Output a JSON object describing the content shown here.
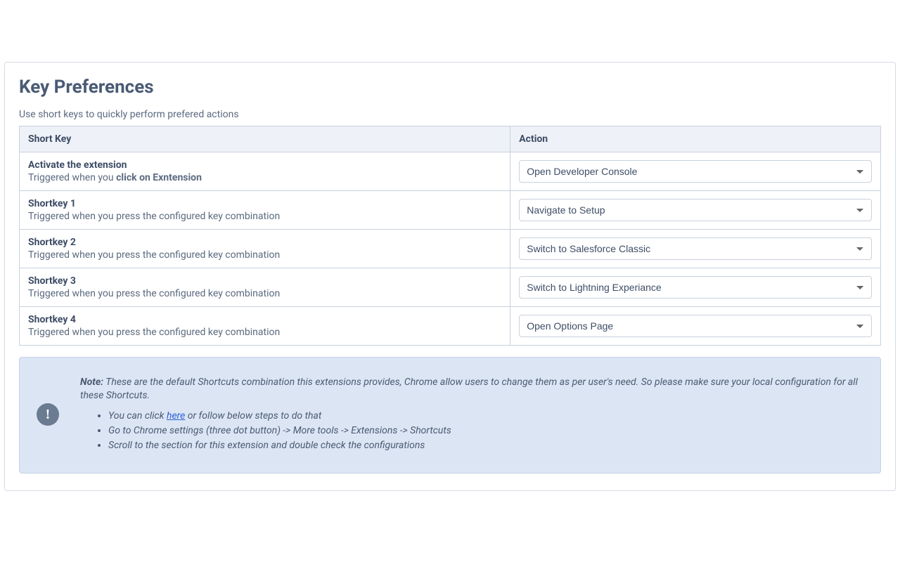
{
  "title": "Key Preferences",
  "subtitle": "Use short keys to quickly perform prefered actions",
  "table": {
    "headers": {
      "shortkey": "Short Key",
      "action": "Action"
    },
    "rows": [
      {
        "name": "Activate the extension",
        "desc_prefix": "Triggered when you ",
        "desc_bold": "click on Exntension",
        "action": "Open Developer Console"
      },
      {
        "name": "Shortkey 1",
        "desc_prefix": "Triggered when you press the configured key combination",
        "desc_bold": "",
        "action": "Navigate to Setup"
      },
      {
        "name": "Shortkey 2",
        "desc_prefix": "Triggered when you press the configured key combination",
        "desc_bold": "",
        "action": "Switch to Salesforce Classic"
      },
      {
        "name": "Shortkey 3",
        "desc_prefix": "Triggered when you press the configured key combination",
        "desc_bold": "",
        "action": "Switch to Lightning Experiance"
      },
      {
        "name": "Shortkey 4",
        "desc_prefix": "Triggered when you press the configured key combination",
        "desc_bold": "",
        "action": "Open Options Page"
      }
    ]
  },
  "note": {
    "label": "Note:",
    "text": " These are the default Shortcuts combination this extensions provides, Chrome allow users to change them as per user's need. So please make sure your local configuration for all these Shortcuts.",
    "bullets": [
      {
        "pre": "You can click ",
        "link": "here",
        "post": " or follow below steps to do that"
      },
      {
        "pre": "Go to Chrome settings (three dot button) -> More tools -> Extensions -> Shortcuts",
        "link": "",
        "post": ""
      },
      {
        "pre": "Scroll to the section for this extension and double check the configurations",
        "link": "",
        "post": ""
      }
    ],
    "icon_glyph": "!"
  }
}
